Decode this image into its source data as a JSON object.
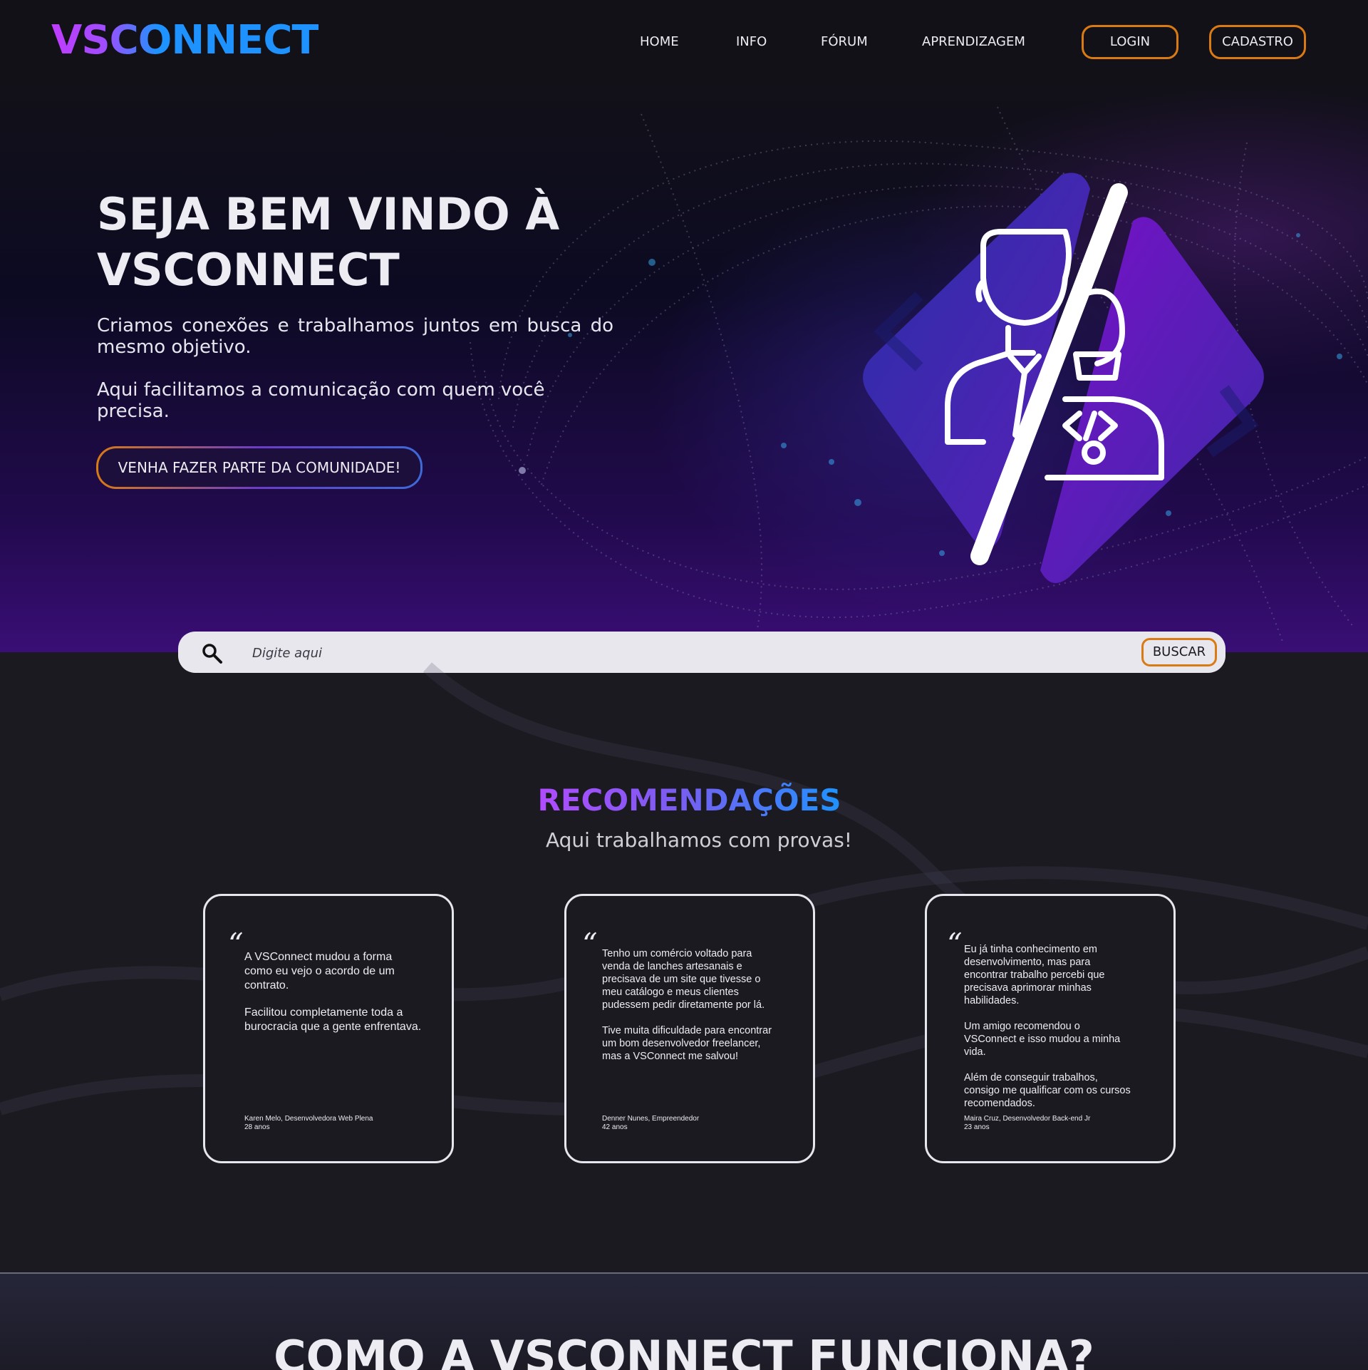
{
  "brand": {
    "logo": "VSCONNECT"
  },
  "nav": {
    "links": [
      "HOME",
      "INFO",
      "FÓRUM",
      "APRENDIZAGEM"
    ],
    "login": "LOGIN",
    "signup": "CADASTRO"
  },
  "hero": {
    "title_line1": "SEJA BEM VINDO À",
    "title_line2": "VSCONNECT",
    "paragraph1": "Criamos conexões e trabalhamos juntos em busca do mesmo objetivo.",
    "paragraph2": "Aqui facilitamos a comunicação com quem você precisa.",
    "cta": "VENHA FAZER PARTE DA COMUNIDADE!",
    "illustration_icon": "client-and-developer-icon"
  },
  "search": {
    "placeholder": "Digite aqui",
    "button": "BUSCAR",
    "icon": "search-icon"
  },
  "recommendations": {
    "title": "RECOMENDAÇÕES",
    "subtitle": "Aqui trabalhamos com provas!",
    "cards": [
      {
        "paragraphs": [
          "A  VSConnect mudou a forma como eu vejo o acordo de um contrato.",
          "Facilitou completamente toda a burocracia que a gente enfrentava."
        ],
        "author": "Karen Melo, Desenvolvedora Web Plena",
        "age": "28 anos"
      },
      {
        "paragraphs": [
          "Tenho um comércio voltado para venda de lanches artesanais e precisava de um site que tivesse o meu catálogo e meus clientes pudessem pedir diretamente por lá.",
          "Tive muita dificuldade para encontrar um bom desenvolvedor freelancer, mas a VSConnect me salvou!"
        ],
        "author": "Denner Nunes, Empreendedor",
        "age": "42 anos"
      },
      {
        "paragraphs": [
          "Eu já tinha conhecimento em desenvolvimento, mas para encontrar trabalho percebi que precisava aprimorar minhas habilidades.",
          "Um amigo recomendou o VSConnect e isso mudou a minha vida.",
          "Além de conseguir trabalhos, consigo me qualificar com os cursos recomendados."
        ],
        "author": "Maira Cruz, Desenvolvedor Back-end Jr",
        "age": "23 anos"
      }
    ]
  },
  "how_it_works": {
    "title": "COMO A VSCONNECT FUNCIONA?"
  },
  "colors": {
    "accent_orange": "#d97a14",
    "brand_purple": "#c03cff",
    "brand_blue": "#1e93ff",
    "background": "#1b1a20"
  }
}
